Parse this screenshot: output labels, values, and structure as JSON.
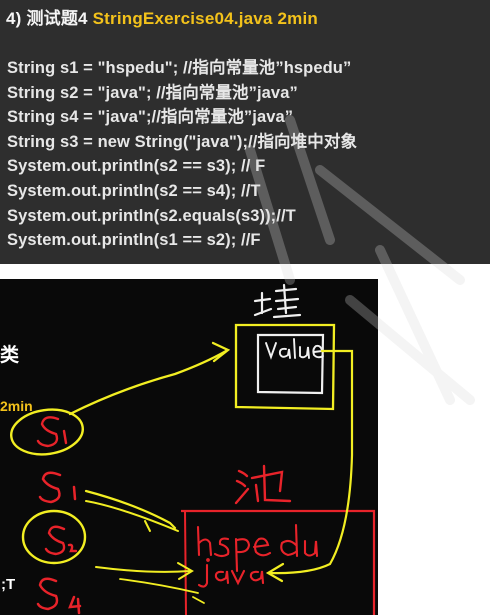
{
  "code_panel": {
    "title_prefix": "4) 测试题4 ",
    "title_file": "StringExercise04.java 2min",
    "lines": [
      "String s1 = \"hspedu\"; //指向常量池”hspedu”",
      "String s2 = \"java\"; //指向常量池”java”",
      "String s4 = \"java\";//指向常量池”java”",
      "String s3 = new String(\"java\");//指向堆中对象",
      "System.out.println(s2 == s3); // F",
      "System.out.println(s2 == s4);  //T",
      "System.out.println(s2.equals(s3));//T",
      "System.out.println(s1 == s2);  //F"
    ]
  },
  "sketch": {
    "side_label": "类",
    "side_min": "2min",
    "side_t": ";T",
    "colors": {
      "board": "#090909",
      "chalk_yellow": "#f2ee22",
      "chalk_red": "#e8232a",
      "chalk_white": "#f0f0f0",
      "code_yellow": "#f3c21b"
    }
  }
}
